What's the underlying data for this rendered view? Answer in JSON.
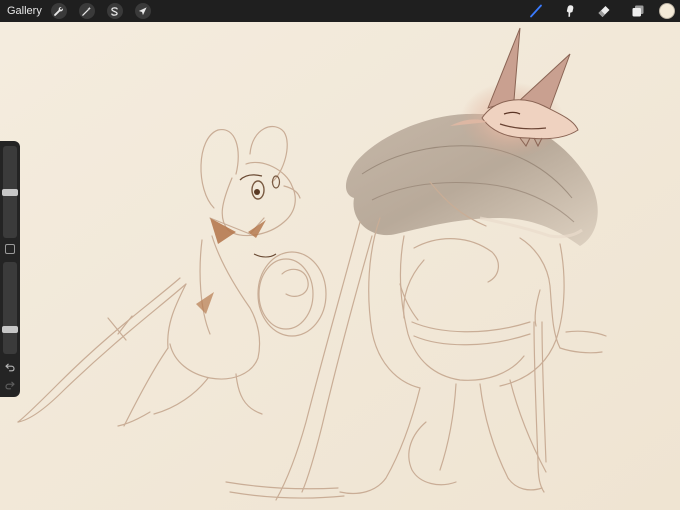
{
  "topbar": {
    "gallery_label": "Gallery",
    "left_tools": [
      "wrench-icon",
      "magic-wand-icon",
      "selection-icon",
      "transform-arrow-icon"
    ],
    "right_tools": [
      "brush-icon",
      "smudge-icon",
      "eraser-icon",
      "layers-icon"
    ],
    "active_tool": "brush-icon",
    "active_color": "#f4ead8",
    "accent_color": "#3a7bff"
  },
  "sidebar": {
    "brush_size_level": 0.5,
    "opacity_level": 0.25
  }
}
